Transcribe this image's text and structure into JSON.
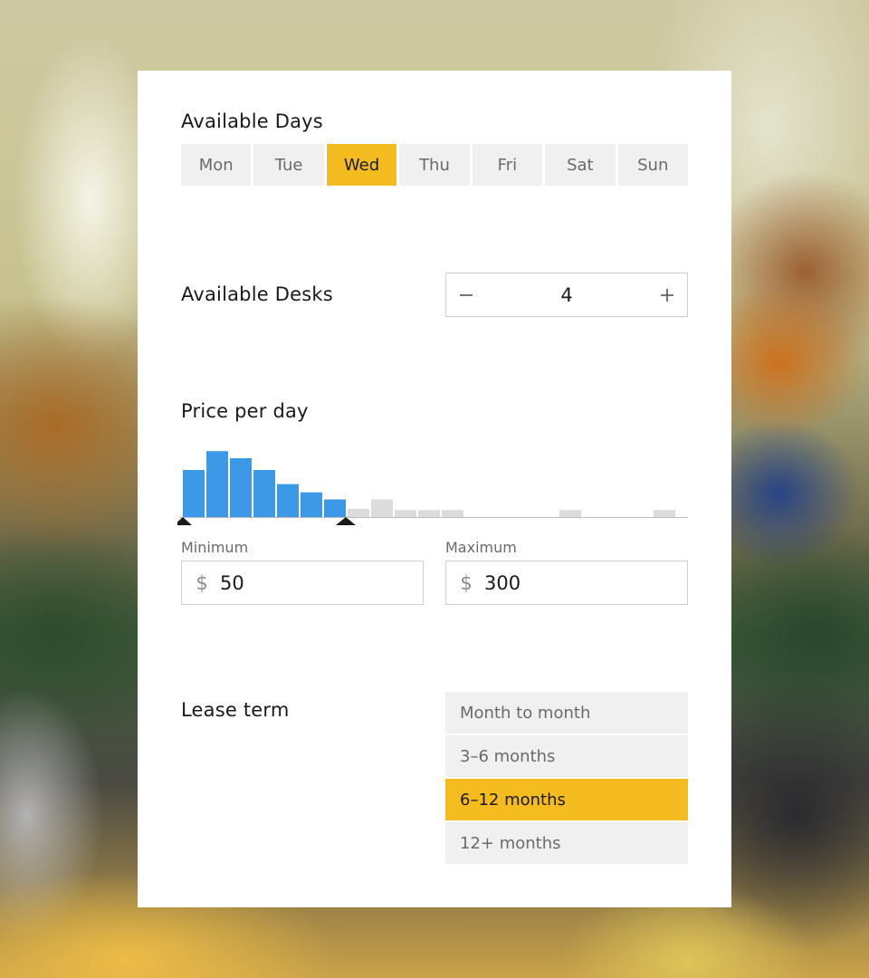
{
  "days": {
    "title": "Available Days",
    "options": [
      "Mon",
      "Tue",
      "Wed",
      "Thu",
      "Fri",
      "Sat",
      "Sun"
    ],
    "selected": "Wed"
  },
  "desks": {
    "title": "Available Desks",
    "value": "4",
    "decrement_icon": "minus-icon",
    "increment_icon": "plus-icon"
  },
  "price": {
    "title": "Price per day",
    "min_label": "Minimum",
    "max_label": "Maximum",
    "currency": "$",
    "min_value": "50",
    "max_value": "300",
    "histogram": {
      "selected_color": "#3b99e8",
      "unselected_color": "#dcdcdc",
      "bins": [
        40,
        56,
        50,
        40,
        28,
        21,
        15,
        7,
        15,
        6,
        6,
        6,
        0,
        0,
        0,
        0,
        6,
        0,
        0,
        0,
        6
      ],
      "selected_range_bins": [
        0,
        6
      ]
    }
  },
  "lease": {
    "title": "Lease term",
    "options": [
      "Month to month",
      "3–6 months",
      "6–12 months",
      "12+ months"
    ],
    "selected": "6–12 months"
  },
  "colors": {
    "accent": "#f5bc20",
    "chip_bg": "#f0f0f0",
    "histogram_blue": "#3b99e8"
  }
}
